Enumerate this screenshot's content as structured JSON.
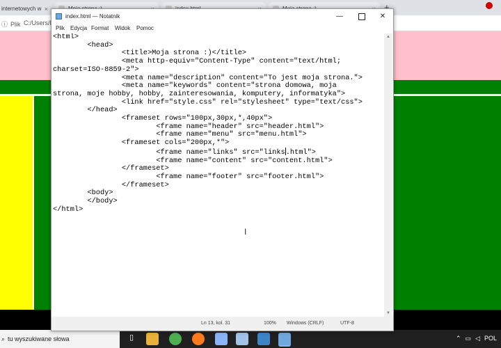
{
  "browser": {
    "tabs": [
      {
        "label": "internetowych w",
        "close": "×"
      },
      {
        "label": "Moja strona :)",
        "close": "×"
      },
      {
        "label": "index.html",
        "close": "×"
      },
      {
        "label": "Moja strona :)",
        "close": "×"
      }
    ],
    "new_tab": "+",
    "address_info": "Plik",
    "address_path": "C:/Users/h"
  },
  "notepad": {
    "title": "index.html — Notatnik",
    "minimize": "—",
    "close": "✕",
    "menu": [
      "Plik",
      "Edycja",
      "Format",
      "Widok",
      "Pomoc"
    ],
    "content_before_caret": "<html>\n\t<head>\n\t\t<title>Moja strona :)</title>\n\t\t<meta http-equiv=\"Content-Type\" content=\"text/html;\ncharset=ISO-8859-2\">\n\t\t<meta name=\"description\" content=\"To jest moja strona.\">\n\t\t<meta name=\"keywords\" content=\"strona domowa, moja\nstrona, moje hobby, hobby, zainteresowania, komputery, informatyka\">\n\t\t<link href=\"style.css\" rel=\"stylesheet\" type=\"text/css\">\n\t</head>\n\t\t<frameset rows=\"100px,30px,*,40px\">\n\t\t\t<frame name=\"header\" src=\"header.html\">\n\t\t\t<frame name=\"menu\" src=\"menu.html\">\n\t\t<frameset cols=\"200px,*\">\n\t\t\t<frame name=\"links\" src=\"links",
    "content_after_caret": ".html\">\n\t\t\t<frame name=\"content\" src=\"content.html\">\n\t\t</frameset>\n\t\t\t<frame name=\"footer\" src=\"footer.html\">\n\t\t</frameset>\n\t<body>\n\t</body>\n</html>",
    "status": {
      "position": "Ln 13, kol. 31",
      "zoom": "100%",
      "line_endings": "Windows (CRLF)",
      "encoding": "UTF-8"
    }
  },
  "taskbar": {
    "search_placeholder": "tu wyszukiwane słowa",
    "tray_text": "POL"
  }
}
